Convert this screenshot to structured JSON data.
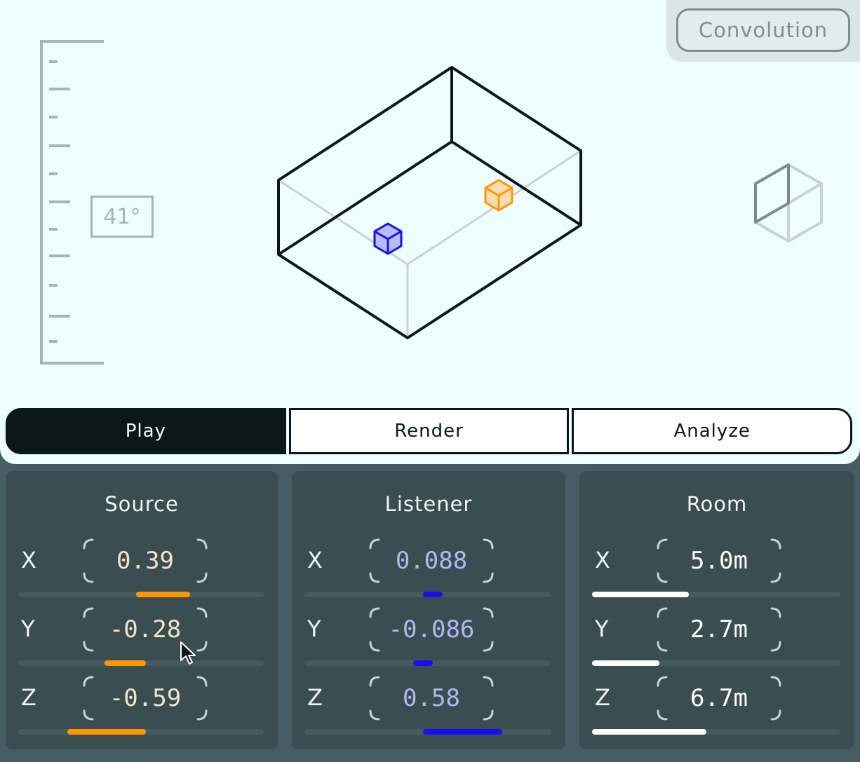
{
  "convolution_button": "Convolution",
  "angle": "41°",
  "modes": [
    "Play",
    "Render",
    "Analyze"
  ],
  "active_mode": "Play",
  "colors": {
    "source": "#ff9500",
    "listener": "#1a0ff0",
    "room": "#ffffff",
    "source_text": "#f2e4c4",
    "listener_text": "#b3b7f0",
    "room_text": "#ffffff"
  },
  "panels": [
    {
      "title": "Source",
      "key": "source",
      "rows": [
        {
          "axis": "X",
          "value": "0.39",
          "fill_start": 0.48,
          "fill_end": 0.7
        },
        {
          "axis": "Y",
          "value": "-0.28",
          "fill_start": 0.35,
          "fill_end": 0.52
        },
        {
          "axis": "Z",
          "value": "-0.59",
          "fill_start": 0.2,
          "fill_end": 0.52
        }
      ]
    },
    {
      "title": "Listener",
      "key": "listener",
      "rows": [
        {
          "axis": "X",
          "value": "0.088",
          "fill_start": 0.48,
          "fill_end": 0.56
        },
        {
          "axis": "Y",
          "value": "-0.086",
          "fill_start": 0.44,
          "fill_end": 0.52
        },
        {
          "axis": "Z",
          "value": "0.58",
          "fill_start": 0.48,
          "fill_end": 0.8
        }
      ]
    },
    {
      "title": "Room",
      "key": "room",
      "rows": [
        {
          "axis": "X",
          "value": "5.0m",
          "fill_start": 0.0,
          "fill_end": 0.39
        },
        {
          "axis": "Y",
          "value": "2.7m",
          "fill_start": 0.0,
          "fill_end": 0.27
        },
        {
          "axis": "Z",
          "value": "6.7m",
          "fill_start": 0.0,
          "fill_end": 0.46
        }
      ]
    }
  ]
}
